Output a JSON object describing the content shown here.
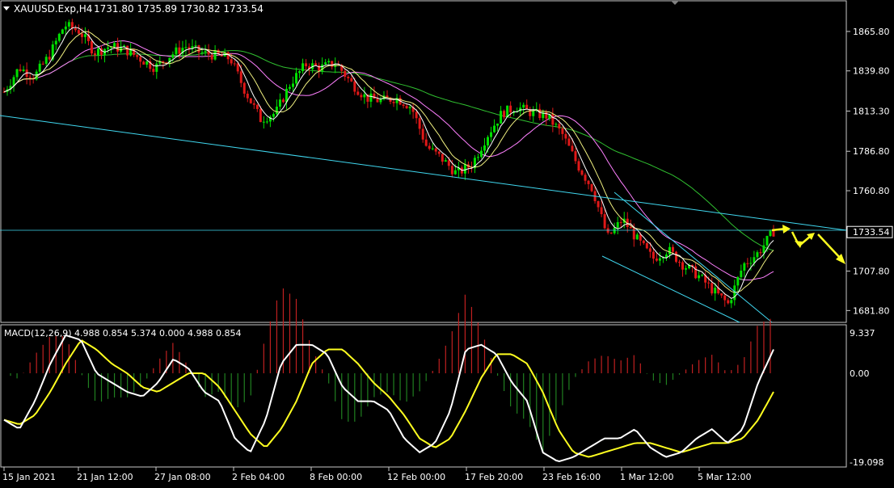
{
  "header": {
    "symbol": "XAUUSD.Exp,H4",
    "ohlc": "1731.80 1735.89 1730.82 1733.54"
  },
  "colors": {
    "background": "#000000",
    "frame": "#c8c8c8",
    "bull": "#00e000",
    "bear": "#e01818",
    "sma_fast": "#ffffff",
    "sma_mid": "#f0f080",
    "sma_slow": "#ff80ff",
    "sma_long": "#30c030",
    "channel": "#40d8f0",
    "forecast": "#ffff20",
    "macd_line": "#ffffff",
    "signal_line": "#ffff20"
  },
  "chart_data": {
    "type": "candlestick",
    "price_axis": {
      "labels": [
        "1865.80",
        "1839.80",
        "1813.30",
        "1786.80",
        "1760.80",
        "1707.80",
        "1681.80"
      ],
      "values": [
        1865.8,
        1839.8,
        1813.3,
        1786.8,
        1760.8,
        1707.8,
        1681.8
      ],
      "range": [
        1674,
        1886
      ]
    },
    "current_price": "1733.54",
    "time_axis": [
      "15 Jan 2021",
      "21 Jan 12:00",
      "27 Jan 08:00",
      "2 Feb 04:00",
      "8 Feb 00:00",
      "12 Feb 00:00",
      "17 Feb 20:00",
      "23 Feb 16:00",
      "1 Mar 12:00",
      "5 Mar 12:00"
    ],
    "price_series": [
      1826,
      1842,
      1836,
      1850,
      1870,
      1866,
      1852,
      1856,
      1854,
      1848,
      1842,
      1850,
      1856,
      1852,
      1850,
      1848,
      1826,
      1808,
      1812,
      1832,
      1844,
      1842,
      1845,
      1832,
      1822,
      1820,
      1822,
      1816,
      1790,
      1782,
      1772,
      1778,
      1797,
      1812,
      1816,
      1812,
      1810,
      1798,
      1778,
      1762,
      1730,
      1742,
      1728,
      1716,
      1722,
      1712,
      1705,
      1695,
      1686,
      1712,
      1720,
      1734
    ],
    "macd": {
      "label": "MACD(12,26,9) 4.988 0.854 5.374 0.000 4.988 0.854",
      "axis_labels": [
        "9.337",
        "0.00",
        "-19.098"
      ],
      "range": [
        -19.098,
        9.337
      ],
      "main": [
        -10,
        -12,
        -6,
        2,
        8,
        7,
        0,
        -2,
        -4,
        -5,
        -2,
        3,
        1,
        -4,
        -6,
        -14,
        -17,
        -10,
        2,
        6,
        6,
        4,
        -3,
        -6,
        -6,
        -8,
        -14,
        -17,
        -15,
        -8,
        5,
        6,
        4,
        -2,
        -6,
        -17,
        -19,
        -18,
        -16,
        -14,
        -14,
        -12,
        -16,
        -18,
        -17,
        -14,
        -12,
        -15,
        -12,
        -2,
        5
      ],
      "signal": [
        -10,
        -11,
        -9,
        -4,
        2,
        7,
        5,
        2,
        0,
        -3,
        -4,
        -2,
        0,
        0,
        -3,
        -8,
        -13,
        -16,
        -12,
        -6,
        2,
        5,
        5,
        2,
        -2,
        -5,
        -9,
        -14,
        -16,
        -14,
        -8,
        -1,
        4,
        4,
        2,
        -4,
        -12,
        -17,
        -18,
        -17,
        -16,
        -15,
        -15,
        -16,
        -17,
        -16,
        -15,
        -15,
        -14,
        -10,
        -4
      ]
    }
  }
}
